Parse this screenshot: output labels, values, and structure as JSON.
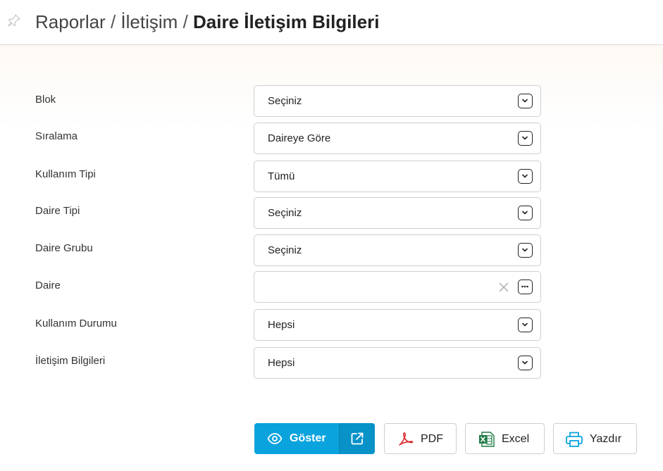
{
  "header": {
    "crumb1": "Raporlar",
    "sep": "/",
    "crumb2": "İletişim",
    "current": "Daire İletişim Bilgileri"
  },
  "form": {
    "fields": [
      {
        "label": "Blok",
        "value": "Seçiniz"
      },
      {
        "label": "Sıralama",
        "value": "Daireye Göre"
      },
      {
        "label": "Kullanım Tipi",
        "value": "Tümü"
      },
      {
        "label": "Daire Tipi",
        "value": "Seçiniz"
      },
      {
        "label": "Daire Grubu",
        "value": "Seçiniz"
      },
      {
        "label": "Daire",
        "value": ""
      },
      {
        "label": "Kullanım Durumu",
        "value": "Hepsi"
      },
      {
        "label": "İletişim Bilgileri",
        "value": "Hepsi"
      }
    ]
  },
  "actions": {
    "show": "Göster",
    "pdf": "PDF",
    "excel": "Excel",
    "print": "Yazdır"
  },
  "colors": {
    "primary": "#0aa3de",
    "pdf": "#d9262c",
    "excel": "#1e7b45",
    "print": "#0aa3de"
  },
  "icons": [
    "pin-icon",
    "chevron-down-icon",
    "clear-icon",
    "more-icon",
    "eye-icon",
    "external-link-icon",
    "pdf-icon",
    "excel-icon",
    "printer-icon"
  ]
}
